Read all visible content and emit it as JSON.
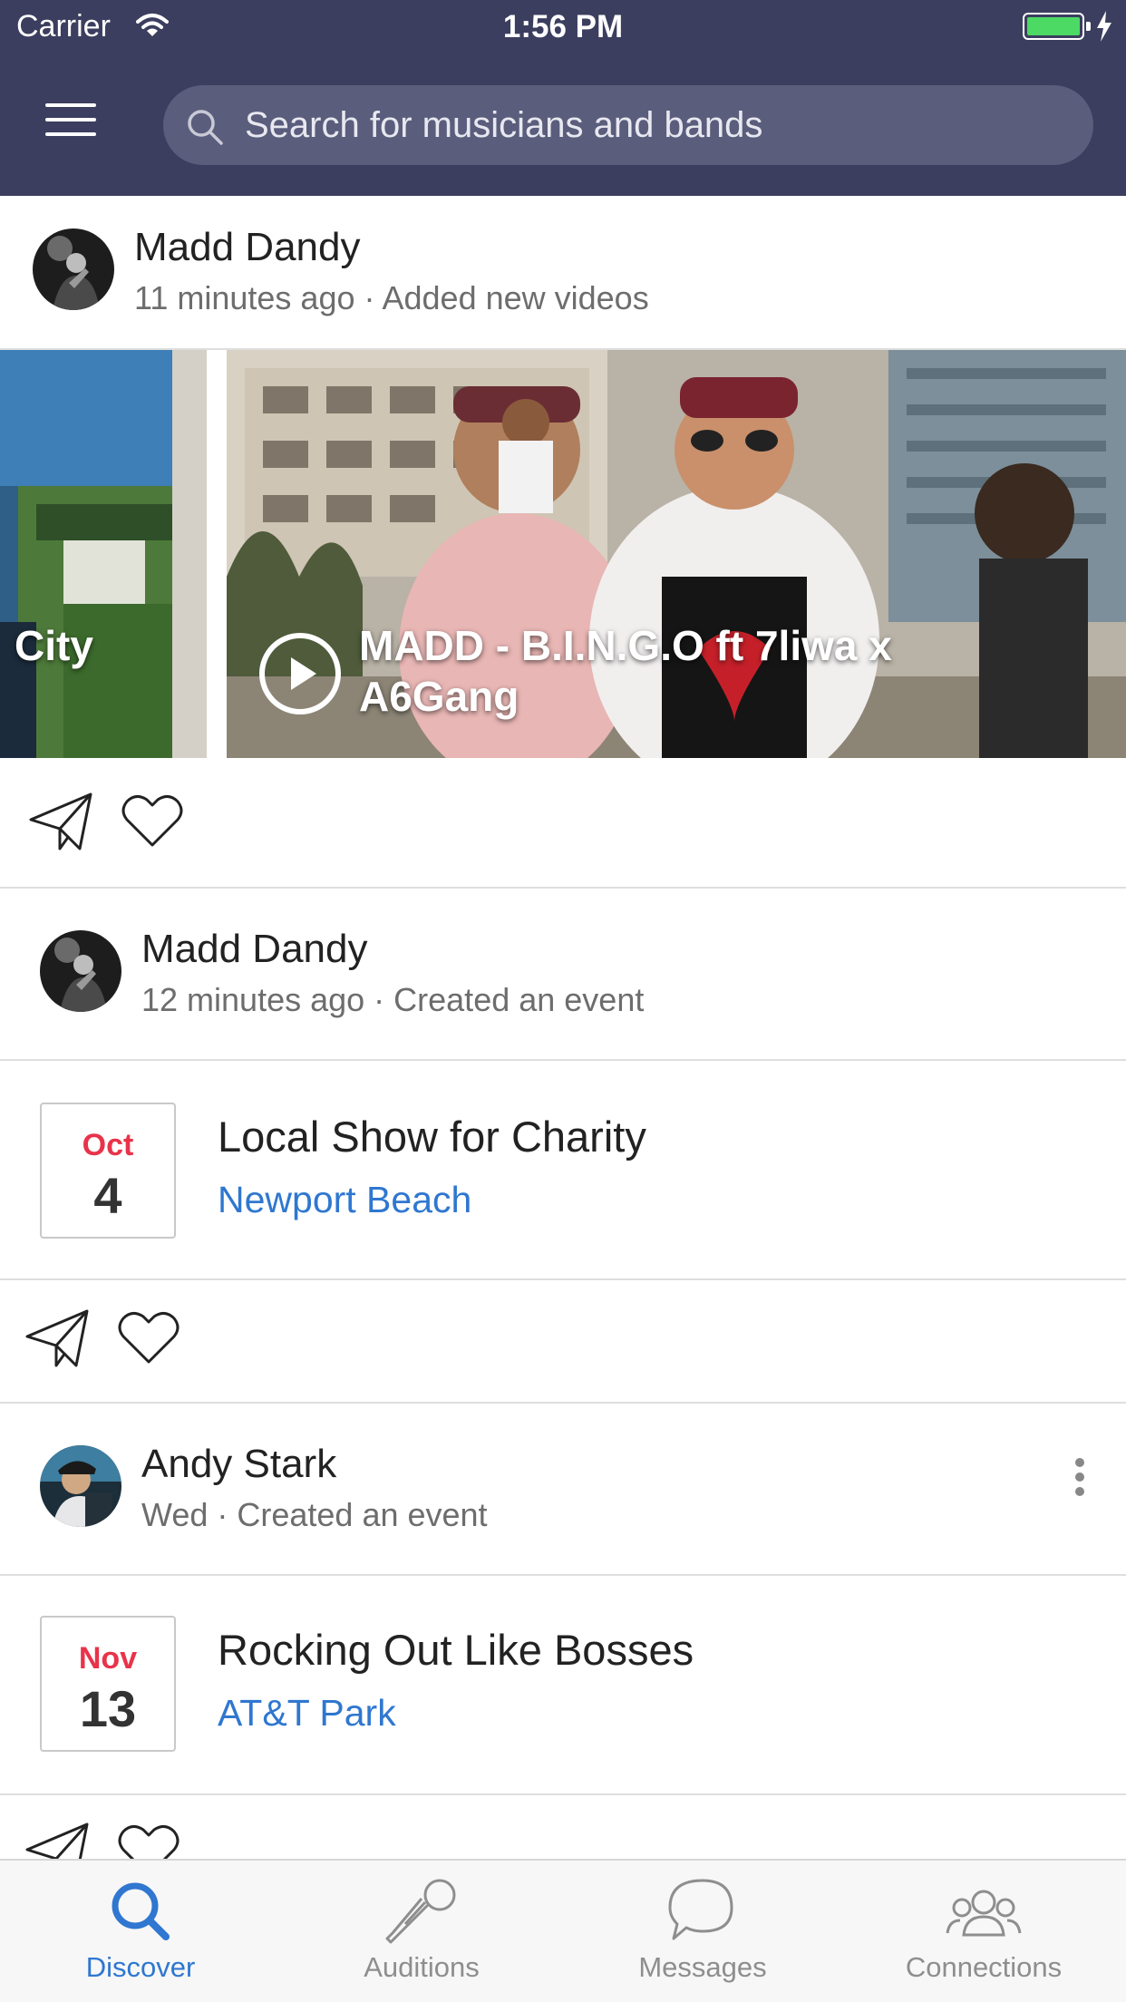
{
  "status_bar": {
    "carrier": "Carrier",
    "time": "1:56 PM"
  },
  "header": {
    "search_placeholder": "Search for musicians and bands"
  },
  "feed": [
    {
      "author": "Madd Dandy",
      "meta": "11 minutes ago · Added new videos",
      "videos": [
        {
          "title": "City"
        },
        {
          "title": "MADD - B.I.N.G.O ft 7liwa x A6Gang"
        }
      ]
    },
    {
      "author": "Madd Dandy",
      "meta": "12 minutes ago · Created an event",
      "event": {
        "month": "Oct",
        "day": "4",
        "title": "Local Show for Charity",
        "location": "Newport Beach"
      }
    },
    {
      "author": "Andy Stark",
      "meta": "Wed · Created an event",
      "event": {
        "month": "Nov",
        "day": "13",
        "title": "Rocking Out Like Bosses",
        "location": "AT&T Park"
      }
    }
  ],
  "tabs": [
    {
      "label": "Discover",
      "icon": "search-icon",
      "active": true
    },
    {
      "label": "Auditions",
      "icon": "microphone-icon",
      "active": false
    },
    {
      "label": "Messages",
      "icon": "chat-bubble-icon",
      "active": false
    },
    {
      "label": "Connections",
      "icon": "people-icon",
      "active": false
    }
  ],
  "colors": {
    "header_bg": "#3b3e5e",
    "search_bg": "#5a5d7c",
    "accent_blue": "#2f77d0",
    "date_red": "#e8334a",
    "battery_green": "#4cd964"
  }
}
